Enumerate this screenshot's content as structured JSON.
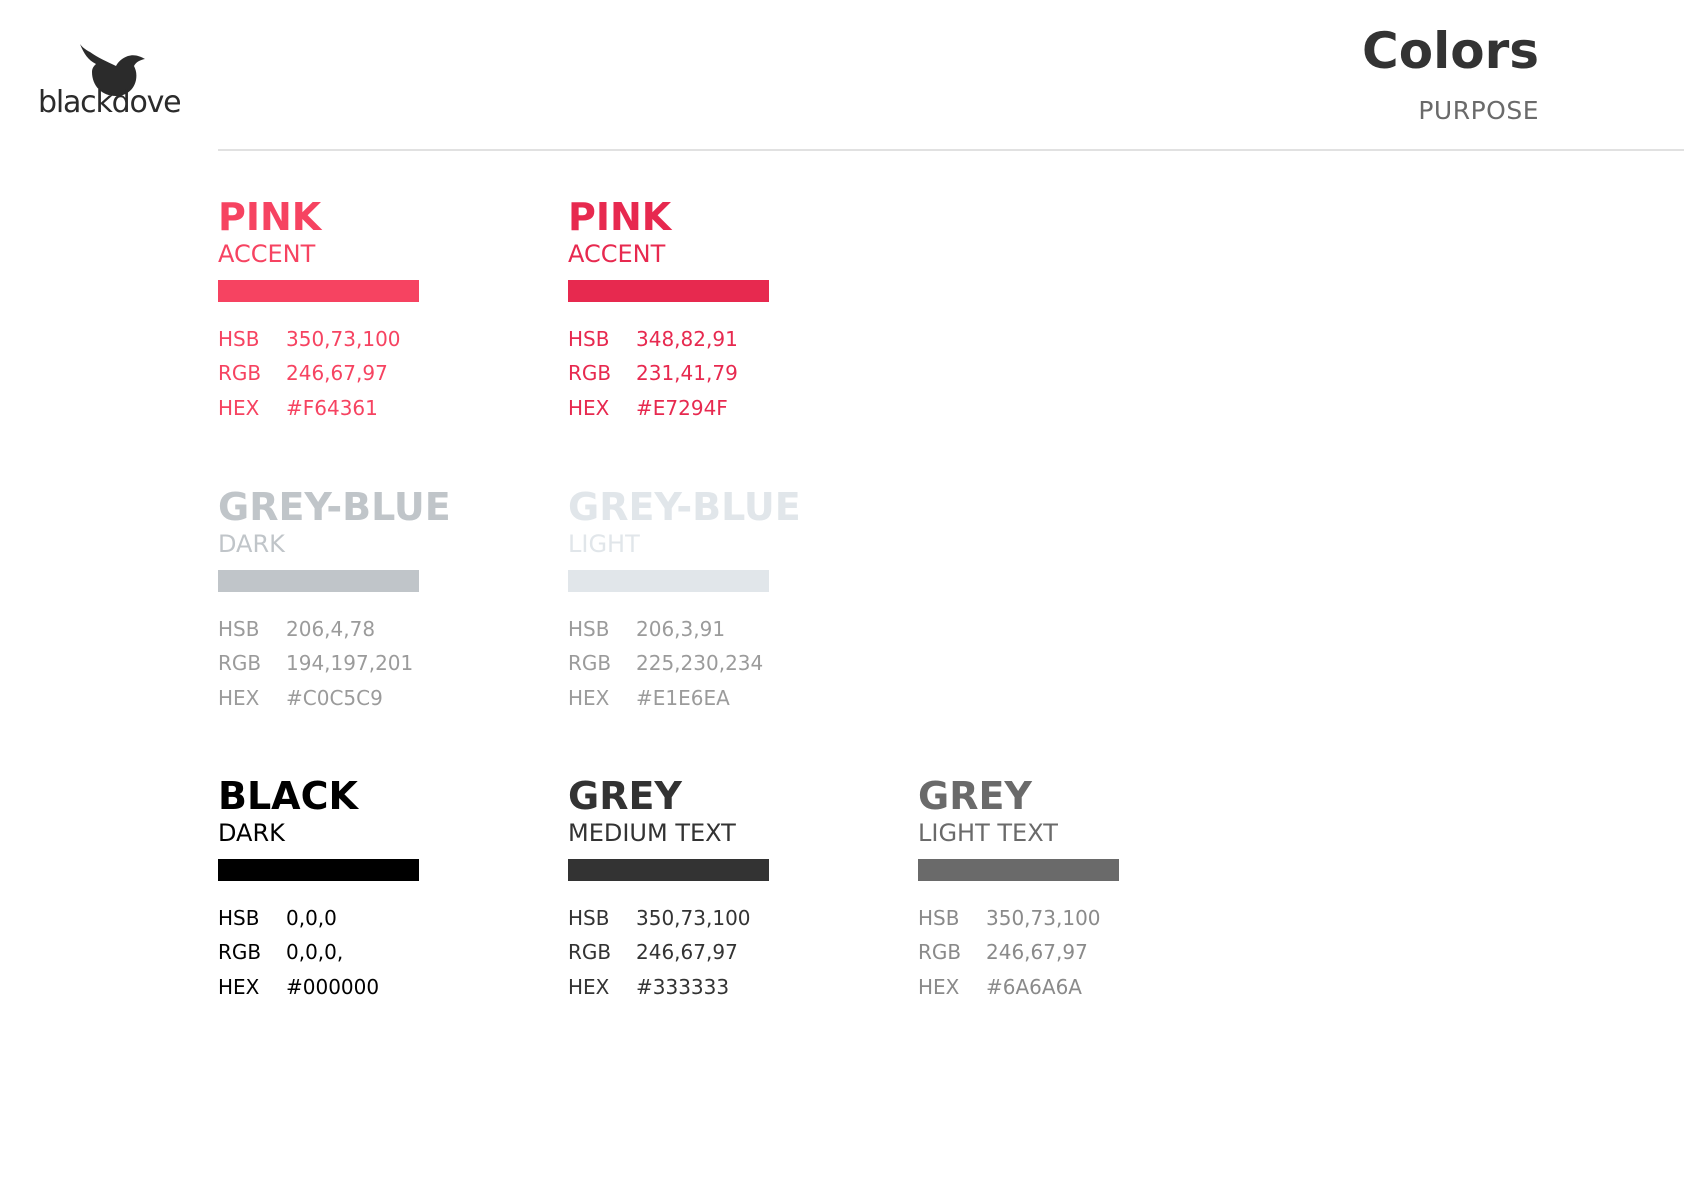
{
  "brand": {
    "name": "blackdove"
  },
  "header": {
    "title": "Colors",
    "subtitle": "PURPOSE"
  },
  "swatches": [
    {
      "name": "PINK",
      "role": "ACCENT",
      "color": "#F64361",
      "text_color": "#F64361",
      "specs": [
        {
          "key": "HSB",
          "value": "350,73,100"
        },
        {
          "key": "RGB",
          "value": "246,67,97"
        },
        {
          "key": "HEX",
          "value": "#F64361"
        }
      ]
    },
    {
      "name": "PINK",
      "role": "ACCENT",
      "color": "#E7294F",
      "text_color": "#E7294F",
      "specs": [
        {
          "key": "HSB",
          "value": "348,82,91"
        },
        {
          "key": "RGB",
          "value": "231,41,79"
        },
        {
          "key": "HEX",
          "value": "#E7294F"
        }
      ]
    },
    {
      "name": "GREY-BLUE",
      "role": "DARK",
      "color": "#C0C5C9",
      "text_color": "#C0C5C9",
      "spec_color": "#9b9b9b",
      "specs": [
        {
          "key": "HSB",
          "value": "206,4,78"
        },
        {
          "key": "RGB",
          "value": "194,197,201"
        },
        {
          "key": "HEX",
          "value": "#C0C5C9"
        }
      ]
    },
    {
      "name": "GREY-BLUE",
      "role": "LIGHT",
      "color": "#E1E6EA",
      "text_color": "#E1E6EA",
      "spec_color": "#9b9b9b",
      "specs": [
        {
          "key": "HSB",
          "value": "206,3,91"
        },
        {
          "key": "RGB",
          "value": "225,230,234"
        },
        {
          "key": "HEX",
          "value": "#E1E6EA"
        }
      ]
    },
    {
      "name": "BLACK",
      "role": "DARK",
      "color": "#000000",
      "text_color": "#000000",
      "specs": [
        {
          "key": "HSB",
          "value": "0,0,0"
        },
        {
          "key": "RGB",
          "value": "0,0,0,"
        },
        {
          "key": "HEX",
          "value": "#000000"
        }
      ]
    },
    {
      "name": "GREY",
      "role": "MEDIUM TEXT",
      "color": "#333333",
      "text_color": "#333333",
      "specs": [
        {
          "key": "HSB",
          "value": "350,73,100"
        },
        {
          "key": "RGB",
          "value": "246,67,97"
        },
        {
          "key": "HEX",
          "value": "#333333"
        }
      ]
    },
    {
      "name": "GREY",
      "role": "LIGHT TEXT",
      "color": "#6A6A6A",
      "text_color": "#6A6A6A",
      "spec_color": "#8a8a8a",
      "specs": [
        {
          "key": "HSB",
          "value": "350,73,100"
        },
        {
          "key": "RGB",
          "value": "246,67,97"
        },
        {
          "key": "HEX",
          "value": "#6A6A6A"
        }
      ]
    }
  ]
}
